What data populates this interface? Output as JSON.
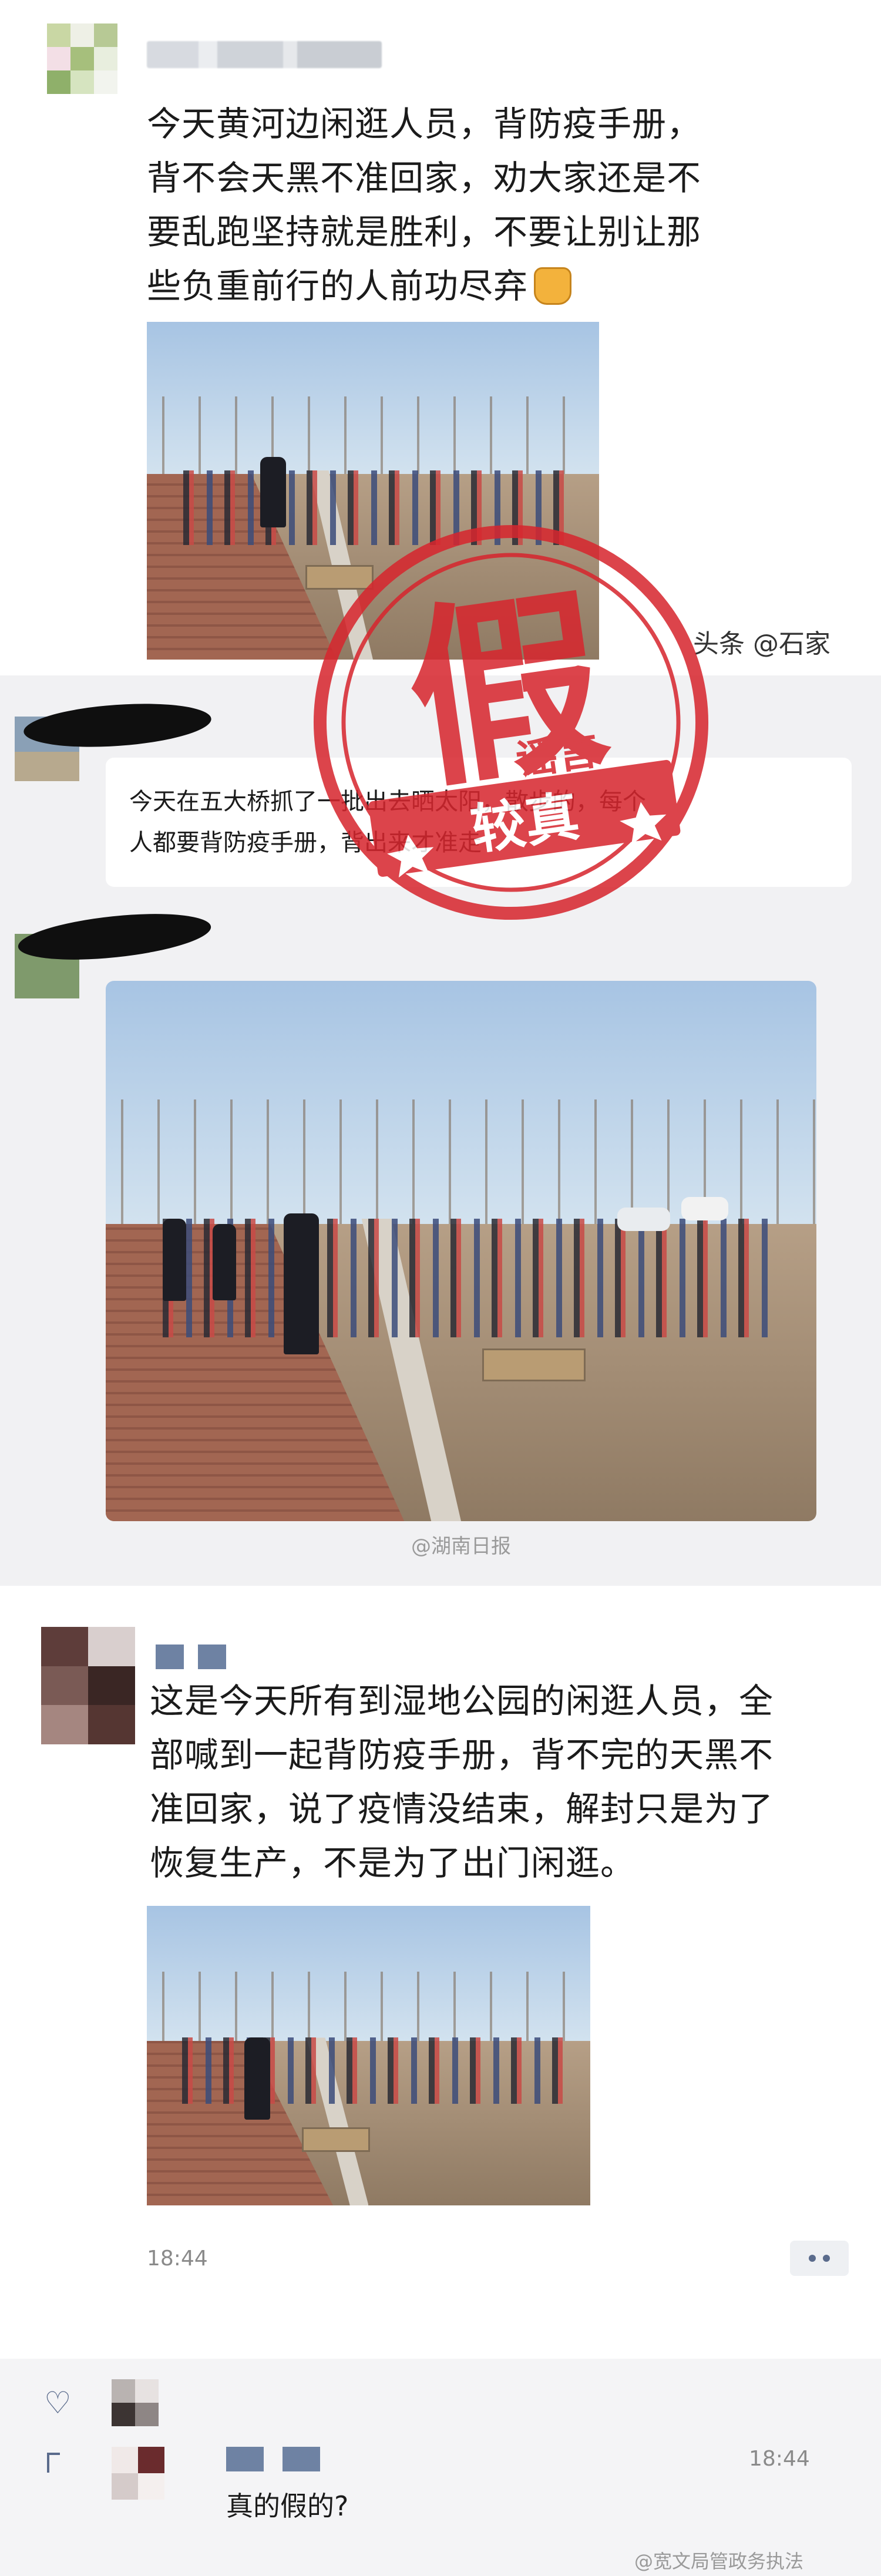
{
  "post1": {
    "text_lines": [
      "今天黄河边闲逛人员，背防疫手册，",
      "背不会天黑不准回家，劝大家还是不",
      "要乱跑坚持就是胜利，不要让别让那",
      "些负重前行的人前功尽弃"
    ],
    "emoji": "fist-emoji",
    "watermark": "头条 @石家"
  },
  "chat": {
    "message_lines": [
      "今天在五大桥抓了一批出去晒太阳，散步的，每个",
      "人都要背防疫手册，背出来才准走"
    ],
    "photo_watermark": "@湖南日报"
  },
  "stamp": {
    "main": "假",
    "top": "谣言",
    "bottom": "较真",
    "color": "#d7262e"
  },
  "post2": {
    "text_lines": [
      "这是今天所有到湿地公园的闲逛人员，全",
      "部喊到一起背防疫手册，背不完的天黑不",
      "准回家，说了疫情没结束，解封只是为了",
      "恢复生产，不是为了出门闲逛。"
    ],
    "time": "18:44"
  },
  "comments": {
    "reply_time": "18:44",
    "reply_text": "真的假的?",
    "footer_watermark": "@宽文局管政务执法"
  },
  "colors": {
    "stamp_red": "#d7262e",
    "link_blue": "#5a6b8c",
    "feed_gray": "#f1f1f3"
  }
}
